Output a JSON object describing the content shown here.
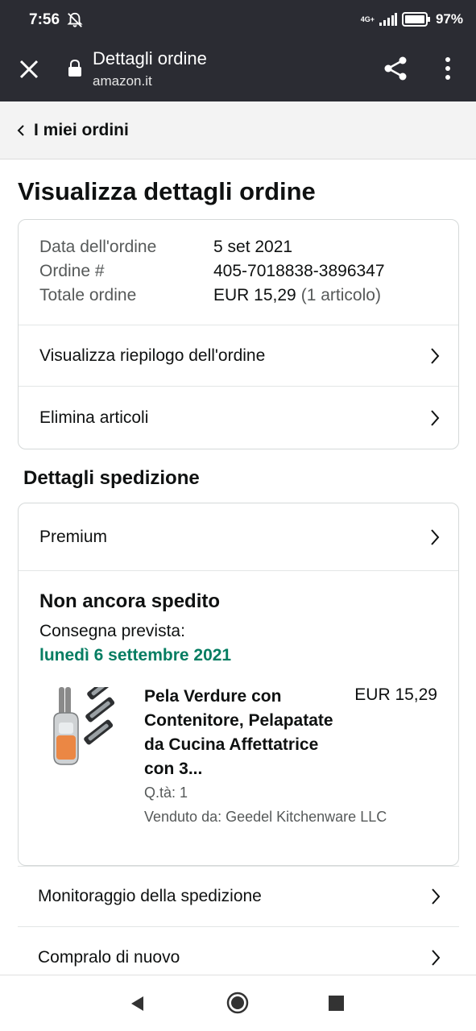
{
  "status_bar": {
    "time": "7:56",
    "network": "4G+",
    "battery": "97%"
  },
  "browser": {
    "title": "Dettagli ordine",
    "domain": "amazon.it"
  },
  "breadcrumb": {
    "label": "I miei ordini"
  },
  "page": {
    "title": "Visualizza dettagli ordine"
  },
  "order_summary": {
    "date_label": "Data dell'ordine",
    "date_value": "5 set 2021",
    "number_label": "Ordine #",
    "number_value": "405-7018838-3896347",
    "total_label": "Totale ordine",
    "total_value": "EUR 15,29",
    "total_items": "(1 articolo)"
  },
  "order_actions": {
    "view_summary": "Visualizza riepilogo dell'ordine",
    "delete_items": "Elimina articoli"
  },
  "shipment": {
    "section_title": "Dettagli spedizione",
    "method": "Premium",
    "status": "Non ancora spedito",
    "delivery_label": "Consegna prevista:",
    "delivery_date": "lunedì 6 settembre 2021",
    "item": {
      "name": "Pela Verdure con Contenitore, Pelapatate da Cucina Affettatrice con 3...",
      "price": "EUR 15,29",
      "quantity": "Q.tà: 1",
      "seller": "Venduto da: Geedel Kitchenware LLC"
    }
  },
  "shipment_actions": {
    "track": "Monitoraggio della spedizione",
    "buy_again": "Compralo di nuovo"
  },
  "colors": {
    "delivery_green": "#067d62",
    "toolbar": "#2b2c33"
  }
}
